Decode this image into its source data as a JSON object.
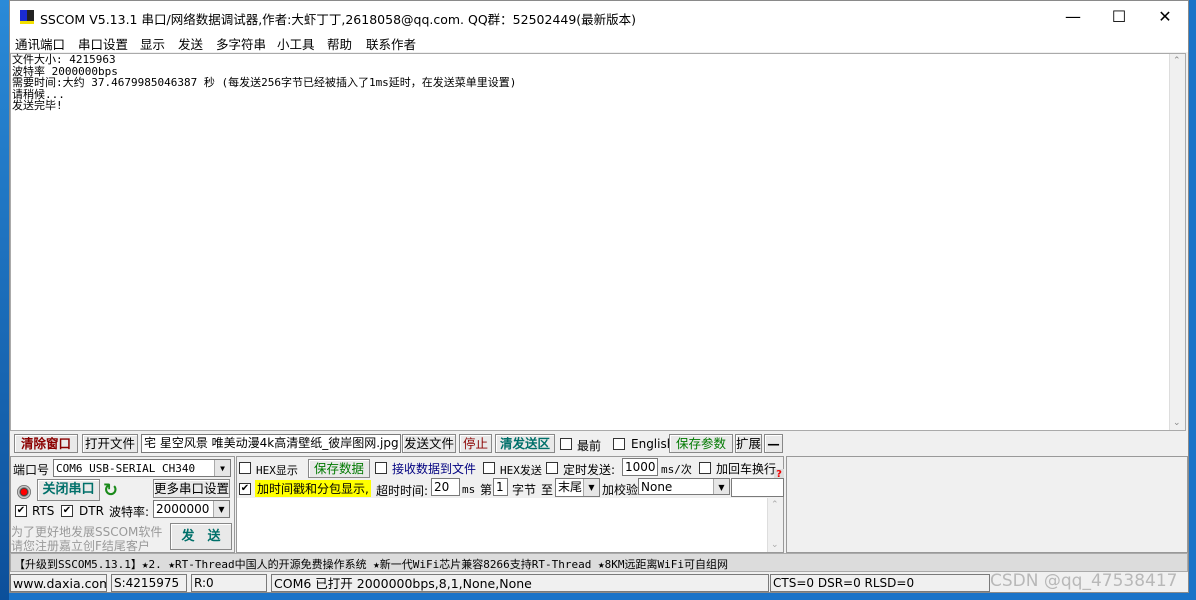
{
  "window": {
    "title": "SSCOM V5.13.1 串口/网络数据调试器,作者:大虾丁丁,2618058@qq.com. QQ群：52502449(最新版本)",
    "minimize": "—",
    "maximize": "☐",
    "close": "✕"
  },
  "menu": [
    "通讯端口",
    "串口设置",
    "显示",
    "发送",
    "多字符串",
    "小工具",
    "帮助",
    "联系作者"
  ],
  "receive_lines": [
    "文件大小: 4215963",
    "波特率 2000000bps",
    "需要时间:大约 37.4679985046387 秒 (每发送256字节已经被插入了1ms延时，在发送菜单里设置)",
    "请稍候...",
    "发送完毕!"
  ],
  "toolbar": {
    "clear": "清除窗口",
    "open_file": "打开文件",
    "file_path": "宅 星空风景 唯美动漫4k高清壁纸_彼岸图网.jpg",
    "send_file": "发送文件",
    "stop": "停止",
    "clear_send": "清发送区",
    "topmost": "最前",
    "english": "English",
    "save_params": "保存参数",
    "expand": "扩展",
    "collapse": "—"
  },
  "port": {
    "label": "端口号",
    "value": "COM6 USB-SERIAL CH340",
    "close_port": "关闭串口",
    "more_settings": "更多串口设置",
    "rts": "RTS",
    "dtr": "DTR",
    "baud_label": "波特率:",
    "baud": "2000000",
    "promo1": "为了更好地发展SSCOM软件",
    "promo2": "请您注册嘉立创F结尾客户",
    "send": "发　送"
  },
  "options": {
    "hex_display": "HEX显示",
    "save_data": "保存数据",
    "recv_to_file": "接收数据到文件",
    "hex_send": "HEX发送",
    "timed_send": "定时发送:",
    "interval": "1000",
    "interval_unit": "ms/次",
    "add_crlf": "加回车换行",
    "help": "?",
    "timestamp": "加时间戳和分包显示,",
    "timeout_label": "超时时间:",
    "timeout": "20",
    "timeout_unit": "ms",
    "nth": "第",
    "byte_from": "1",
    "byte_label": "字节",
    "to": "至",
    "to_value": "末尾",
    "checksum_label": "加校验",
    "checksum": "None",
    "timestamp_checked": true,
    "rts_checked": true,
    "dtr_checked": true
  },
  "ticker": "【升级到SSCOM5.13.1】★2. ★RT-Thread中国人的开源免费操作系统 ★新一代WiFi芯片兼容8266支持RT-Thread ★8KM远距离WiFi可自组网",
  "status": {
    "site": "www.daxia.com",
    "sent": "S:4215975",
    "recv": "R:0",
    "port": "COM6 已打开  2000000bps,8,1,None,None",
    "lines": "CTS=0 DSR=0 RLSD=0"
  },
  "watermark": "CSDN @qq_47538417"
}
